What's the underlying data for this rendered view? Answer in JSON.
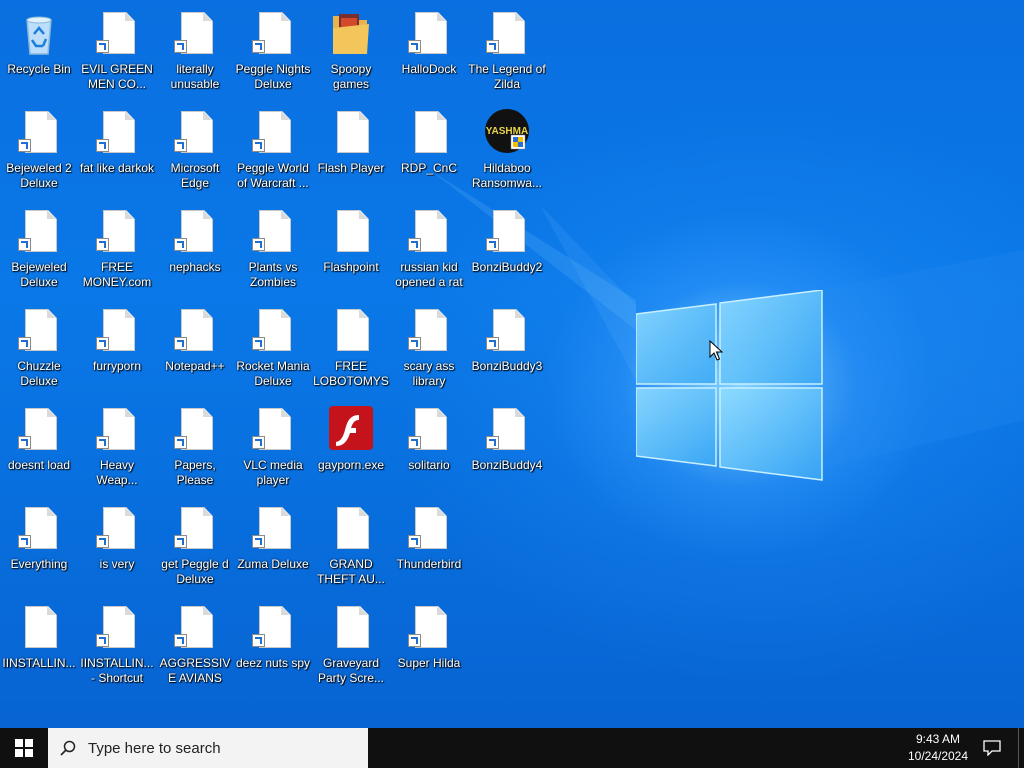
{
  "desktop": {
    "icons": [
      {
        "label": "Recycle Bin",
        "kind": "recycle-bin"
      },
      {
        "label": "EVIL GREEN MEN CO...",
        "kind": "shortcut"
      },
      {
        "label": "literally unusable",
        "kind": "shortcut"
      },
      {
        "label": "Peggle Nights Deluxe",
        "kind": "shortcut"
      },
      {
        "label": "Spoopy games",
        "kind": "folder"
      },
      {
        "label": "HalloDock",
        "kind": "shortcut"
      },
      {
        "label": "The Legend of Zilda",
        "kind": "shortcut"
      },
      {
        "label": "Bejeweled 2 Deluxe",
        "kind": "shortcut"
      },
      {
        "label": "fat like darkok",
        "kind": "shortcut"
      },
      {
        "label": "Microsoft Edge",
        "kind": "shortcut"
      },
      {
        "label": "Peggle World of Warcraft ...",
        "kind": "shortcut"
      },
      {
        "label": "Flash Player",
        "kind": "file"
      },
      {
        "label": "RDP_CnC",
        "kind": "file"
      },
      {
        "label": "Hildaboo Ransomwa...",
        "kind": "yashma",
        "badge": "YASHMA"
      },
      {
        "label": "Bejeweled Deluxe",
        "kind": "shortcut"
      },
      {
        "label": "FREE MONEY.com",
        "kind": "shortcut"
      },
      {
        "label": "nephacks",
        "kind": "shortcut"
      },
      {
        "label": "Plants vs Zombies",
        "kind": "shortcut"
      },
      {
        "label": "Flashpoint",
        "kind": "file"
      },
      {
        "label": "russian kid opened a rat",
        "kind": "shortcut"
      },
      {
        "label": "BonziBuddy2",
        "kind": "shortcut"
      },
      {
        "label": "Chuzzle Deluxe",
        "kind": "shortcut"
      },
      {
        "label": "furryporn",
        "kind": "shortcut"
      },
      {
        "label": "Notepad++",
        "kind": "shortcut"
      },
      {
        "label": "Rocket Mania Deluxe",
        "kind": "shortcut"
      },
      {
        "label": "FREE LOBOTOMYS",
        "kind": "file"
      },
      {
        "label": "scary ass library",
        "kind": "shortcut"
      },
      {
        "label": "BonziBuddy3",
        "kind": "shortcut"
      },
      {
        "label": "doesnt load",
        "kind": "shortcut"
      },
      {
        "label": "Heavy Weap...",
        "kind": "shortcut"
      },
      {
        "label": "Papers, Please",
        "kind": "shortcut"
      },
      {
        "label": "VLC media player",
        "kind": "shortcut"
      },
      {
        "label": "gayporn.exe",
        "kind": "flash"
      },
      {
        "label": "solitario",
        "kind": "shortcut"
      },
      {
        "label": "BonziBuddy4",
        "kind": "shortcut"
      },
      {
        "label": "Everything",
        "kind": "shortcut"
      },
      {
        "label": "is very",
        "kind": "shortcut"
      },
      {
        "label": "get Peggle d Deluxe",
        "kind": "shortcut"
      },
      {
        "label": "Zuma Deluxe",
        "kind": "shortcut"
      },
      {
        "label": "GRAND THEFT AU...",
        "kind": "file"
      },
      {
        "label": "Thunderbird",
        "kind": "shortcut"
      },
      null,
      {
        "label": "IINSTALLIN...",
        "kind": "file"
      },
      {
        "label": "IINSTALLIN... - Shortcut",
        "kind": "shortcut"
      },
      {
        "label": "AGGRESSIVE AVIANS",
        "kind": "shortcut"
      },
      {
        "label": "deez nuts spy",
        "kind": "shortcut"
      },
      {
        "label": "Graveyard Party Scre...",
        "kind": "file"
      },
      {
        "label": "Super Hilda",
        "kind": "shortcut"
      },
      null
    ]
  },
  "taskbar": {
    "search_placeholder": "Type here to search",
    "time": "9:43 AM",
    "date": "10/24/2024"
  },
  "colors": {
    "taskbar": "#101010",
    "desktop_blue": "#0a78e8",
    "search_bg": "#f3f3f3"
  }
}
